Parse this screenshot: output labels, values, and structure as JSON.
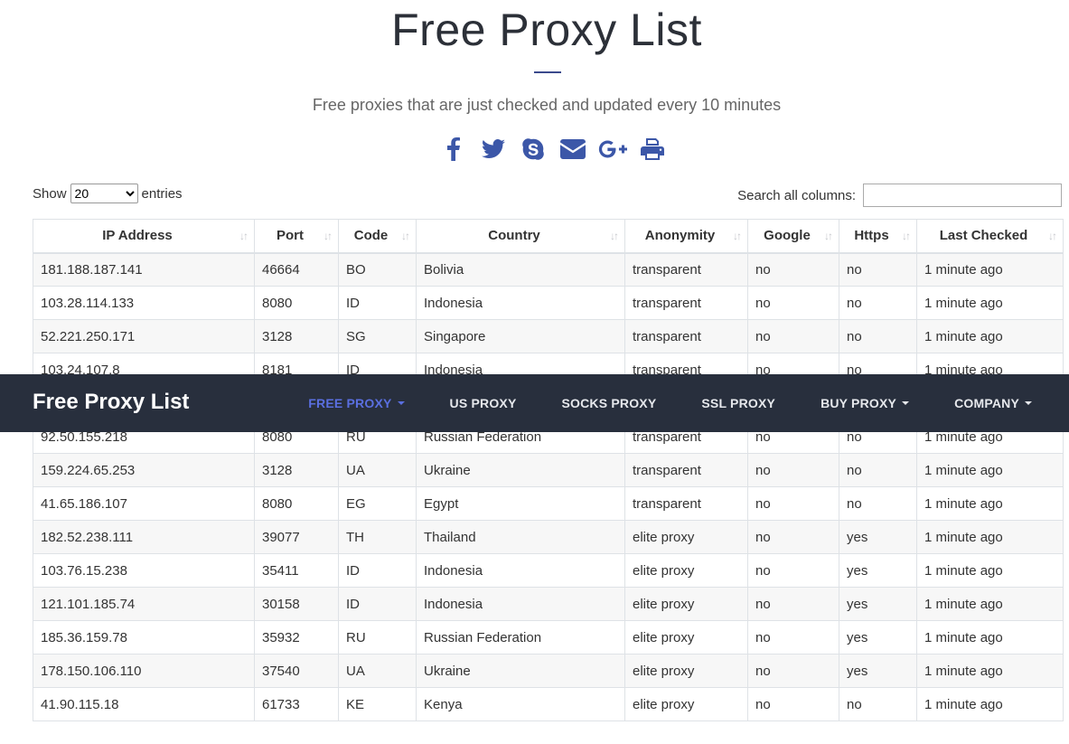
{
  "hero": {
    "title": "Free Proxy List",
    "subtitle": "Free proxies that are just checked and updated every 10 minutes"
  },
  "share_icons": [
    "facebook-icon",
    "twitter-icon",
    "skype-icon",
    "email-icon",
    "google-plus-icon",
    "print-icon"
  ],
  "controls": {
    "show_label": "Show",
    "entries_value": "20",
    "entries_label": "entries",
    "search_label": "Search all columns:",
    "search_value": ""
  },
  "table": {
    "headers": [
      "IP Address",
      "Port",
      "Code",
      "Country",
      "Anonymity",
      "Google",
      "Https",
      "Last Checked"
    ],
    "rows": [
      [
        "181.188.187.141",
        "46664",
        "BO",
        "Bolivia",
        "transparent",
        "no",
        "no",
        "1 minute ago"
      ],
      [
        "103.28.114.133",
        "8080",
        "ID",
        "Indonesia",
        "transparent",
        "no",
        "no",
        "1 minute ago"
      ],
      [
        "52.221.250.171",
        "3128",
        "SG",
        "Singapore",
        "transparent",
        "no",
        "no",
        "1 minute ago"
      ],
      [
        "103.24.107.8",
        "8181",
        "ID",
        "Indonesia",
        "transparent",
        "no",
        "no",
        "1 minute ago"
      ],
      [
        "",
        "",
        "",
        "",
        "",
        "",
        "",
        ""
      ],
      [
        "92.50.155.218",
        "8080",
        "RU",
        "Russian Federation",
        "transparent",
        "no",
        "no",
        "1 minute ago"
      ],
      [
        "159.224.65.253",
        "3128",
        "UA",
        "Ukraine",
        "transparent",
        "no",
        "no",
        "1 minute ago"
      ],
      [
        "41.65.186.107",
        "8080",
        "EG",
        "Egypt",
        "transparent",
        "no",
        "no",
        "1 minute ago"
      ],
      [
        "182.52.238.111",
        "39077",
        "TH",
        "Thailand",
        "elite proxy",
        "no",
        "yes",
        "1 minute ago"
      ],
      [
        "103.76.15.238",
        "35411",
        "ID",
        "Indonesia",
        "elite proxy",
        "no",
        "yes",
        "1 minute ago"
      ],
      [
        "121.101.185.74",
        "30158",
        "ID",
        "Indonesia",
        "elite proxy",
        "no",
        "yes",
        "1 minute ago"
      ],
      [
        "185.36.159.78",
        "35932",
        "RU",
        "Russian Federation",
        "elite proxy",
        "no",
        "yes",
        "1 minute ago"
      ],
      [
        "178.150.106.110",
        "37540",
        "UA",
        "Ukraine",
        "elite proxy",
        "no",
        "yes",
        "1 minute ago"
      ],
      [
        "41.90.115.18",
        "61733",
        "KE",
        "Kenya",
        "elite proxy",
        "no",
        "no",
        "1 minute ago"
      ]
    ]
  },
  "navbar": {
    "brand": "Free Proxy List",
    "items": [
      {
        "label": "FREE PROXY",
        "dropdown": true,
        "active": true
      },
      {
        "label": "US PROXY",
        "dropdown": false,
        "active": false
      },
      {
        "label": "SOCKS PROXY",
        "dropdown": false,
        "active": false
      },
      {
        "label": "SSL PROXY",
        "dropdown": false,
        "active": false
      },
      {
        "label": "BUY PROXY",
        "dropdown": true,
        "active": false
      },
      {
        "label": "COMPANY",
        "dropdown": true,
        "active": false
      }
    ]
  },
  "colors": {
    "navbar_bg": "#282f3d",
    "accent": "#3c57a8",
    "active_nav": "#5a6fe0"
  }
}
